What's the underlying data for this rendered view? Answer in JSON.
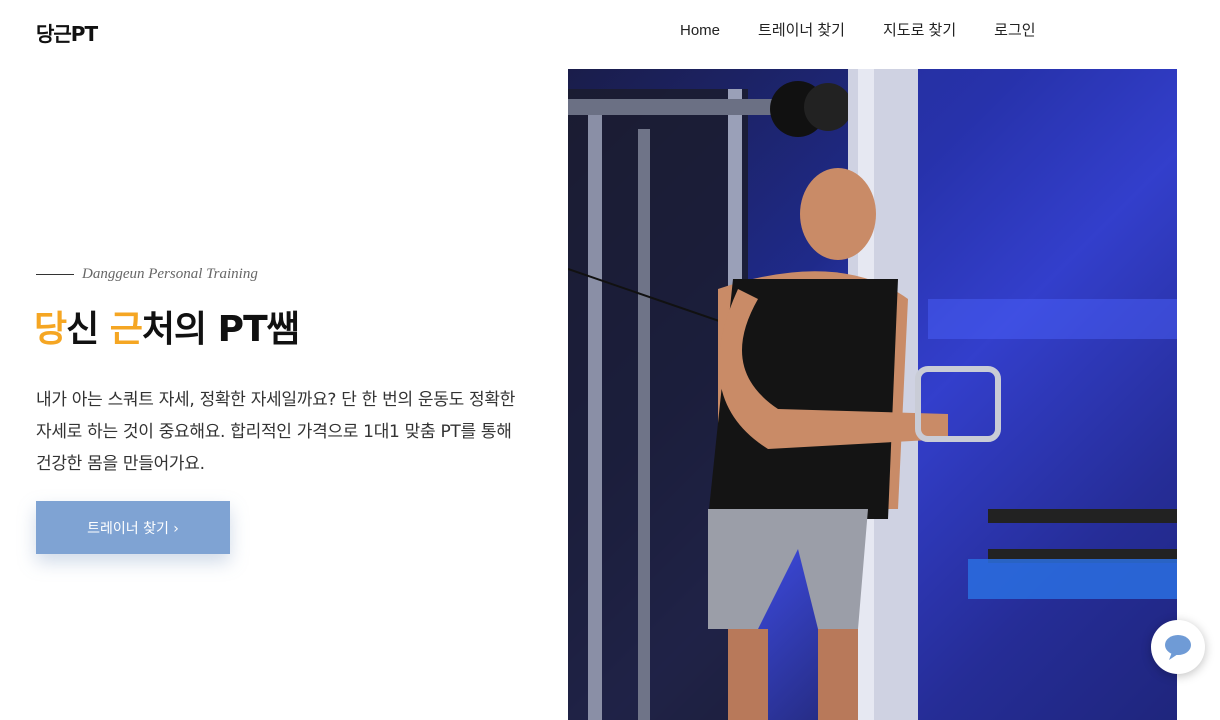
{
  "header": {
    "logo": "당근PT",
    "nav": [
      {
        "label": "Home"
      },
      {
        "label": "트레이너 찾기"
      },
      {
        "label": "지도로 찾기"
      },
      {
        "label": "로그인"
      }
    ]
  },
  "hero": {
    "tagline": "Danggeun Personal Training",
    "headline": {
      "part1_highlight": "당",
      "part2": "신 ",
      "part3_highlight": "근",
      "part4": "처의 PT쌤"
    },
    "description": "내가 아는 스쿼트 자세, 정확한 자세일까요? 단 한 번의 운동도 정확한 자세로 하는 것이 중요해요. 합리적인 가격으로 1대1 맞춤 PT를 통해 건강한 몸을 만들어가요.",
    "cta_label": "트레이너 찾기 ›",
    "image_icon": "gym-trainer-photo"
  },
  "chat": {
    "icon": "chat-bubble-icon"
  },
  "colors": {
    "accent": "#f5a623",
    "button": "#7fa3d3",
    "image_blue": "#3a47d4"
  }
}
